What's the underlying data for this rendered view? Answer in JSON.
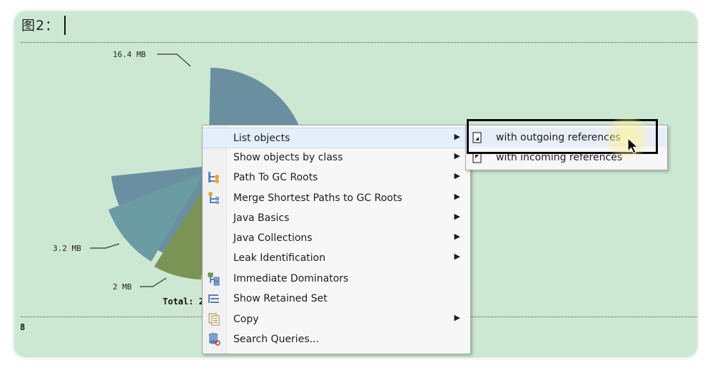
{
  "document": {
    "heading": "图2：",
    "footer_fragment": "8"
  },
  "chart_data": {
    "type": "pie",
    "slice_labels": [
      "16.4 MB",
      "3.2 MB",
      "2 MB"
    ],
    "values": [
      16.4,
      3.2,
      2
    ],
    "total_label": "Total: 2",
    "colors": [
      "#6a8fa0",
      "#6b9ba3",
      "#7a9456",
      "#dfe3dc"
    ]
  },
  "context_menu": {
    "items": [
      {
        "label": "List objects",
        "icon": "none",
        "has_submenu": true,
        "highlighted": true
      },
      {
        "label": "Show objects by class",
        "icon": "none",
        "has_submenu": true,
        "highlighted": false
      },
      {
        "label": "Path To GC Roots",
        "icon": "path-tree-icon",
        "has_submenu": true,
        "highlighted": false
      },
      {
        "label": "Merge Shortest Paths to GC Roots",
        "icon": "merge-tree-icon",
        "has_submenu": true,
        "highlighted": false
      },
      {
        "label": "Java Basics",
        "icon": "none",
        "has_submenu": true,
        "highlighted": false
      },
      {
        "label": "Java Collections",
        "icon": "none",
        "has_submenu": true,
        "highlighted": false
      },
      {
        "label": "Leak Identification",
        "icon": "none",
        "has_submenu": true,
        "highlighted": false
      },
      {
        "label": "Immediate Dominators",
        "icon": "dominator-tree-icon",
        "has_submenu": false,
        "highlighted": false
      },
      {
        "label": "Show Retained Set",
        "icon": "retained-set-icon",
        "has_submenu": false,
        "highlighted": false
      },
      {
        "label": "Copy",
        "icon": "copy-icon",
        "has_submenu": true,
        "highlighted": false
      },
      {
        "label": "Search Queries...",
        "icon": "database-search-icon",
        "has_submenu": false,
        "highlighted": false
      }
    ],
    "submenu_arrow": "▶"
  },
  "submenu": {
    "items": [
      {
        "label": "with outgoing references",
        "icon": "outgoing-references-icon",
        "highlighted": true
      },
      {
        "label": "with incoming references",
        "icon": "incoming-references-icon",
        "highlighted": false
      }
    ]
  }
}
